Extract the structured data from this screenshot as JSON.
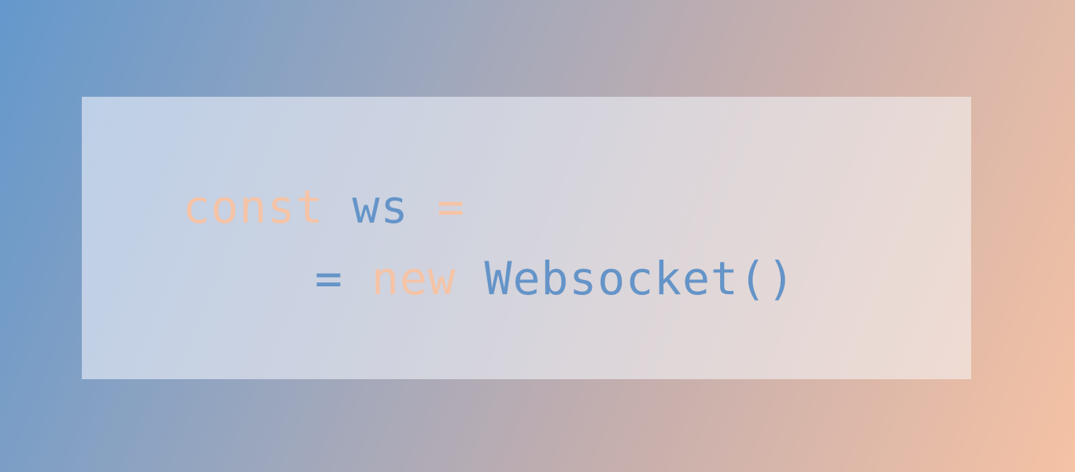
{
  "code": {
    "line1": {
      "keyword": "const",
      "identifier": "ws",
      "operator": "="
    },
    "line2": {
      "operator": "=",
      "keyword": "new",
      "call": "Websocket()"
    }
  },
  "colors": {
    "keyword": "#f5c3a6",
    "identifier": "#6494c8",
    "background_start": "#6498cc",
    "background_end": "#f5c2a4"
  }
}
